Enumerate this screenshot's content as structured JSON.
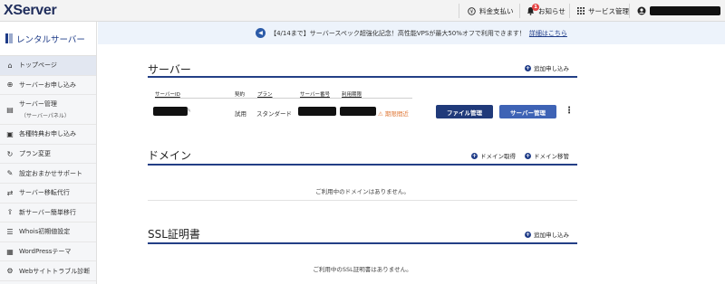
{
  "app": {
    "logo": "XServer"
  },
  "topnav": {
    "payment": "料金支払い",
    "notifications": "お知らせ",
    "notifications_badge": "1",
    "services": "サービス管理"
  },
  "sidebar": {
    "title": "レンタルサーバー",
    "items": [
      {
        "label": "トップページ",
        "icon": "home-icon"
      },
      {
        "label": "サーバーお申し込み",
        "icon": "plus-icon"
      },
      {
        "label": "サーバー管理",
        "sub": "（サーバーパネル）",
        "icon": "server-icon"
      },
      {
        "label": "各種特典お申し込み",
        "icon": "gift-icon"
      },
      {
        "label": "プラン変更",
        "icon": "refresh-icon"
      },
      {
        "label": "設定おまかせサポート",
        "icon": "wrench-icon"
      },
      {
        "label": "サーバー移転代行",
        "icon": "transfer-icon"
      },
      {
        "label": "新サーバー簡単移行",
        "icon": "upload-icon"
      },
      {
        "label": "Whois初期値設定",
        "icon": "list-icon"
      },
      {
        "label": "WordPressテーマ",
        "icon": "theme-icon"
      },
      {
        "label": "Webサイトトラブル診断",
        "icon": "diagnose-icon"
      }
    ]
  },
  "notice": {
    "text": "【4/14まで】サーバースペック超強化記念！高性能VPSが最大50%オフで利用できます！",
    "link": "詳細はこちら"
  },
  "server_section": {
    "title": "サーバー",
    "action": "追加申し込み",
    "columns": [
      "サーバーID",
      "契約",
      "プラン",
      "サーバー番号",
      "利用期限"
    ],
    "row": {
      "contract": "試用",
      "plan": "スタンダード",
      "expiry_status": "⚠ 期限間近",
      "file_button": "ファイル管理",
      "server_button": "サーバー管理"
    }
  },
  "domain_section": {
    "title": "ドメイン",
    "action_get": "ドメイン取得",
    "action_move": "ドメイン移管",
    "empty": "ご利用中のドメインはありません。"
  },
  "ssl_section": {
    "title": "SSL証明書",
    "action": "追加申し込み",
    "empty": "ご利用中のSSL証明書はありません。"
  }
}
